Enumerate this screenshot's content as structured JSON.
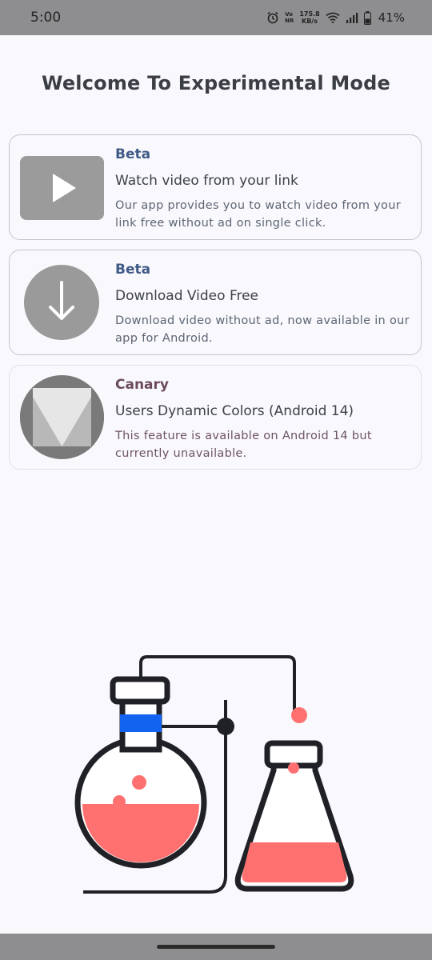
{
  "status_bar": {
    "time": "5:00",
    "network_speed_value": "175.8",
    "network_speed_unit": "KB/s",
    "volte_line1": "Vo",
    "volte_line2": "NR",
    "battery_percent": "41%",
    "icons": [
      "alarm-icon",
      "wifi-icon",
      "signal-icon",
      "battery-icon"
    ]
  },
  "page": {
    "title": "Welcome To Experimental Mode"
  },
  "features": [
    {
      "badge": "Beta",
      "badge_color": "#3f5a86",
      "title": "Watch video from your link",
      "description": "Our app provides you to watch video from your link free without ad on single click.",
      "description_color": "#5d6675",
      "icon": "play-icon"
    },
    {
      "badge": "Beta",
      "badge_color": "#3f5a86",
      "title": "Download Video Free",
      "description": "Download video without ad, now available in our app for Android.",
      "description_color": "#5d6675",
      "icon": "download-icon"
    },
    {
      "badge": "Canary",
      "badge_color": "#6b4a5c",
      "title": "Users Dynamic Colors (Android 14)",
      "description": "This feature is available on Android 14 but currently unavailable.",
      "description_color": "#6e5563",
      "icon": "material-you-icon"
    }
  ],
  "illustration": {
    "icon": "chemistry-flasks-illustration",
    "accent_color": "#ff7170",
    "stopper_band_color": "#1163f0"
  }
}
